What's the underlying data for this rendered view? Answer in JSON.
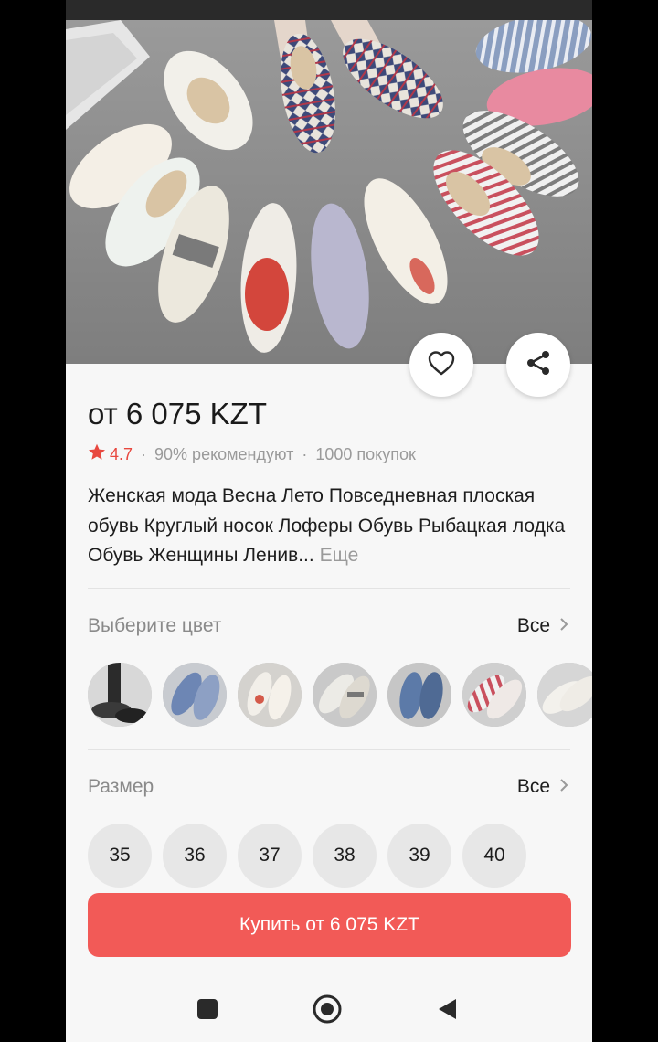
{
  "product": {
    "price": "от 6 075 KZT",
    "rating": "4.7",
    "recommend": "90% рекомендуют",
    "purchases": "1000 покупок",
    "description": "Женская мода Весна Лето Повседневная плоская обувь Круглый носок Лоферы Обувь Рыбацкая лодка Обувь Женщины Ленив...",
    "more_label": "Еще"
  },
  "color_section": {
    "label": "Выберите цвет",
    "all_label": "Все"
  },
  "size_section": {
    "label": "Размер",
    "all_label": "Все",
    "sizes": [
      "35",
      "36",
      "37",
      "38",
      "39",
      "40"
    ]
  },
  "buy_button": {
    "label": "Купить от 6 075 KZT"
  },
  "colors": {
    "accent": "#f25a57",
    "star": "#e8483f"
  },
  "icons": {
    "favorite": "heart-icon",
    "share": "share-icon",
    "rating": "star-icon",
    "chevron": "chevron-right-icon",
    "nav_recents": "square-icon",
    "nav_home": "circle-icon",
    "nav_back": "triangle-back-icon"
  }
}
